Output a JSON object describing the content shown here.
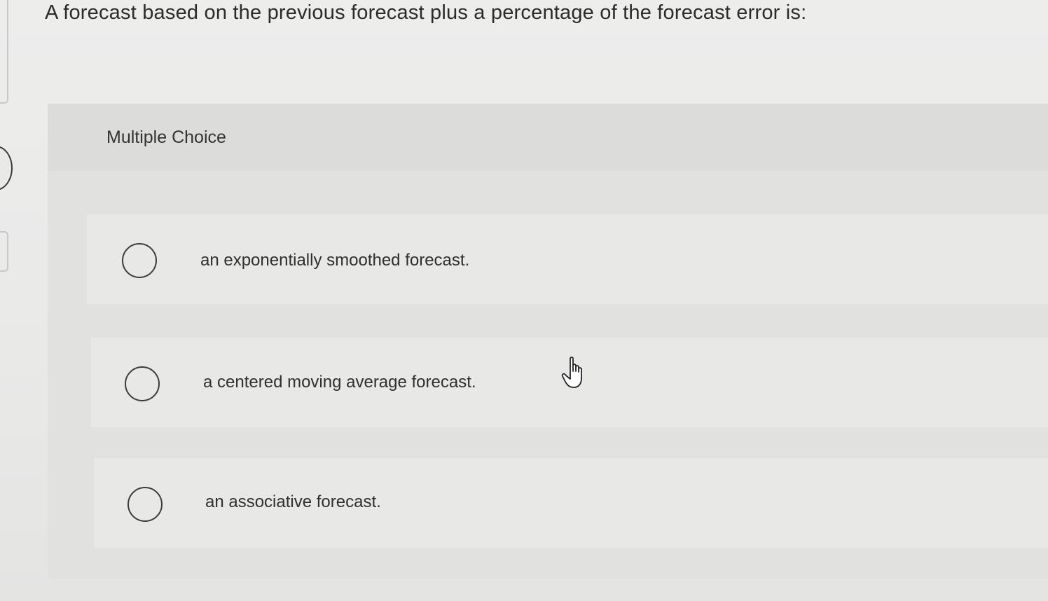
{
  "question": {
    "text": "A forecast based on the previous forecast plus a percentage of the forecast error is:"
  },
  "panel": {
    "label": "Multiple Choice"
  },
  "options": [
    {
      "label": "an exponentially smoothed forecast.",
      "selected": false
    },
    {
      "label": "a centered moving average forecast.",
      "selected": false
    },
    {
      "label": "an associative forecast.",
      "selected": false
    }
  ],
  "cursor": {
    "icon": "hand-pointer-icon"
  }
}
